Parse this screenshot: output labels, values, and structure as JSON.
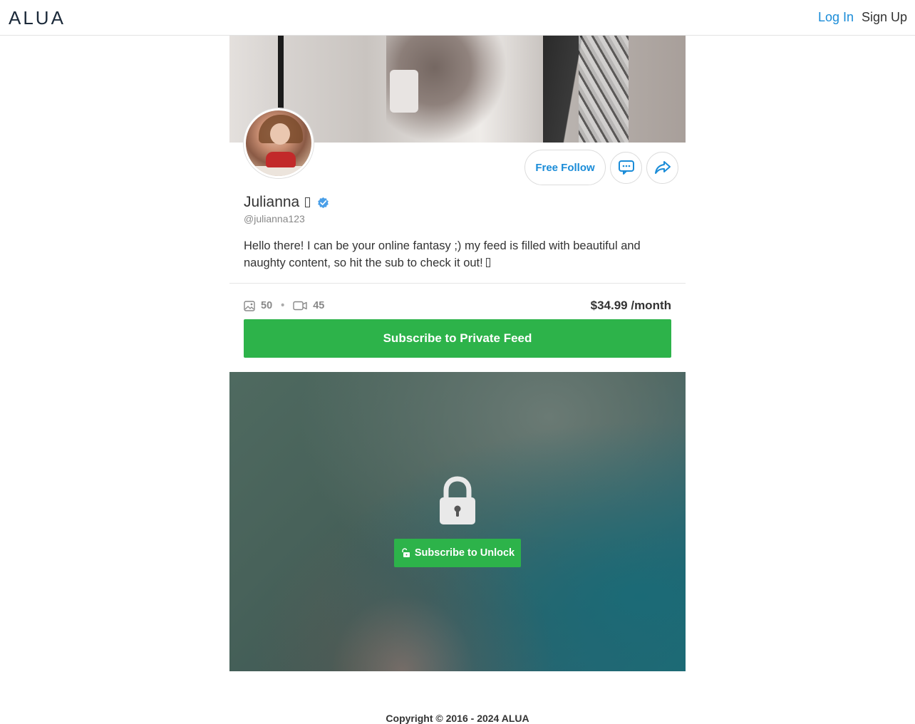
{
  "header": {
    "logo": "ALUA",
    "login_label": "Log In",
    "signup_label": "Sign Up"
  },
  "profile": {
    "name": "Julianna",
    "verified_icon": "verified-check-icon",
    "handle": "@julianna123",
    "bio": "Hello there! I can be your online fantasy ;) my feed is filled with beautiful and naughty content, so hit the sub to check it out!",
    "follow_label": "Free Follow",
    "message_icon": "chat-icon",
    "share_icon": "share-icon"
  },
  "stats": {
    "photos_count": "50",
    "videos_count": "45",
    "separator": "•",
    "price": "$34.99 /month"
  },
  "subscribe": {
    "label": "Subscribe to Private Feed"
  },
  "locked_post": {
    "unlock_label": "Subscribe to Unlock"
  },
  "footer": {
    "copyright": "Copyright © 2016 - 2024 ALUA"
  },
  "colors": {
    "accent_blue": "#1a8cd8",
    "accent_green": "#2db34a",
    "verified_blue": "#4a9fe8"
  }
}
